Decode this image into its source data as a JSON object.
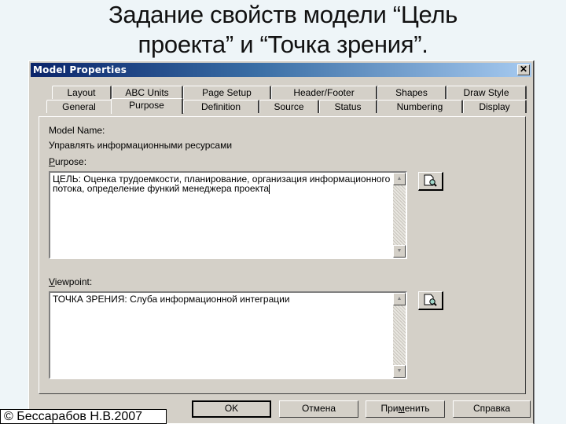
{
  "slide": {
    "title_line1": "Задание свойств модели “Цель",
    "title_line2": "проекта” и “Точка зрения”."
  },
  "dialog": {
    "title": "Model Properties",
    "close_glyph": "✕",
    "tabs_back": [
      {
        "label": "Layout"
      },
      {
        "label": "ABC Units"
      },
      {
        "label": "Page Setup"
      },
      {
        "label": "Header/Footer"
      },
      {
        "label": "Shapes"
      },
      {
        "label": "Draw Style"
      }
    ],
    "tabs_front": [
      {
        "label": "General"
      },
      {
        "label": "Purpose",
        "active": true
      },
      {
        "label": "Definition"
      },
      {
        "label": "Source"
      },
      {
        "label": "Status"
      },
      {
        "label": "Numbering"
      },
      {
        "label": "Display"
      }
    ],
    "model_name_label": "Model Name:",
    "model_name_value": "Управлять информационными ресурсами",
    "purpose_label_mnemonic": "P",
    "purpose_label_rest": "urpose:",
    "purpose_text": "ЦЕЛЬ: Оценка трудоемкости, планирование, организация информационного потока, определение функий менеджера проекта",
    "viewpoint_label_mnemonic": "V",
    "viewpoint_label_rest": "iewpoint:",
    "viewpoint_text": "ТОЧКА ЗРЕНИЯ: Слуба информационной интеграции",
    "buttons": {
      "ok": "OK",
      "cancel": "Отмена",
      "apply_pre": "При",
      "apply_mnemonic": "м",
      "apply_post": "енить",
      "help": "Справка"
    }
  },
  "footer": {
    "copyright": "© Бессарабов Н.В.2007"
  }
}
